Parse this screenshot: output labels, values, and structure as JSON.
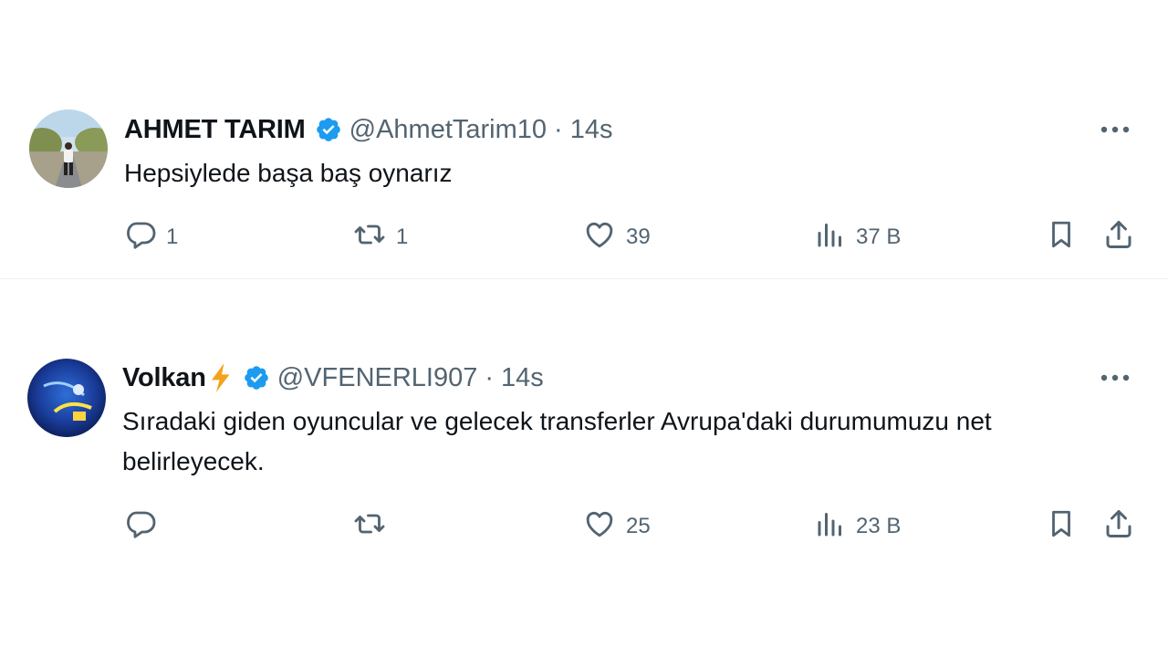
{
  "tweets": [
    {
      "name": "AHMET TARIM",
      "emoji": "",
      "handle": "@AhmetTarim10",
      "separator": "·",
      "time": "14s",
      "text": "Hepsiylede başa baş oynarız",
      "replies": "1",
      "retweets": "1",
      "likes": "39",
      "views": "37 B"
    },
    {
      "name": "Volkan",
      "emoji": "⚡",
      "handle": "@VFENERLI907",
      "separator": "·",
      "time": "14s",
      "text": "Sıradaki giden oyuncular ve gelecek transferler Avrupa'daki durumumuzu net belirleyecek.",
      "replies": "",
      "retweets": "",
      "likes": "25",
      "views": "23 B"
    }
  ],
  "colors": {
    "verified": "#1d9bf0",
    "icon": "#536471",
    "text": "#0f1419",
    "divider": "#eff3f4"
  },
  "icons": [
    "verified-badge-icon",
    "more-icon",
    "reply-icon",
    "retweet-icon",
    "like-icon",
    "views-icon",
    "bookmark-icon",
    "share-icon"
  ]
}
